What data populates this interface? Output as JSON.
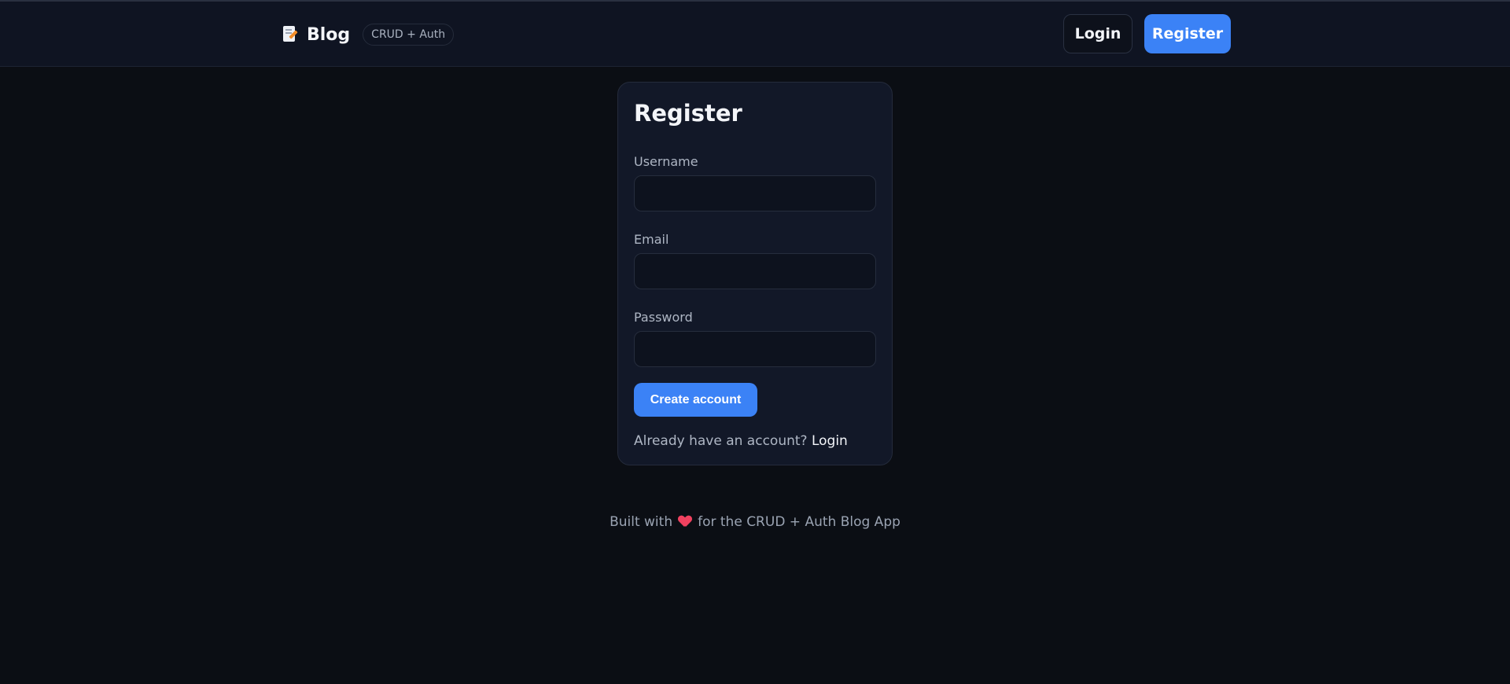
{
  "header": {
    "brand_icon": "memo-icon",
    "brand_title": "Blog",
    "badge": "CRUD + Auth",
    "login_label": "Login",
    "register_label": "Register"
  },
  "form": {
    "title": "Register",
    "fields": [
      {
        "label": "Username",
        "value": "",
        "placeholder": ""
      },
      {
        "label": "Email",
        "value": "",
        "placeholder": ""
      },
      {
        "label": "Password",
        "value": "",
        "placeholder": ""
      }
    ],
    "submit_label": "Create account",
    "switch_text": "Already have an account?",
    "switch_link": "Login"
  },
  "footer": {
    "prefix": "Built with",
    "icon": "heart-icon",
    "suffix": "for the CRUD + Auth Blog App"
  },
  "colors": {
    "accent": "#3b82f6",
    "background": "#0b0e14",
    "card": "#121828",
    "heart": "#f0415f"
  }
}
